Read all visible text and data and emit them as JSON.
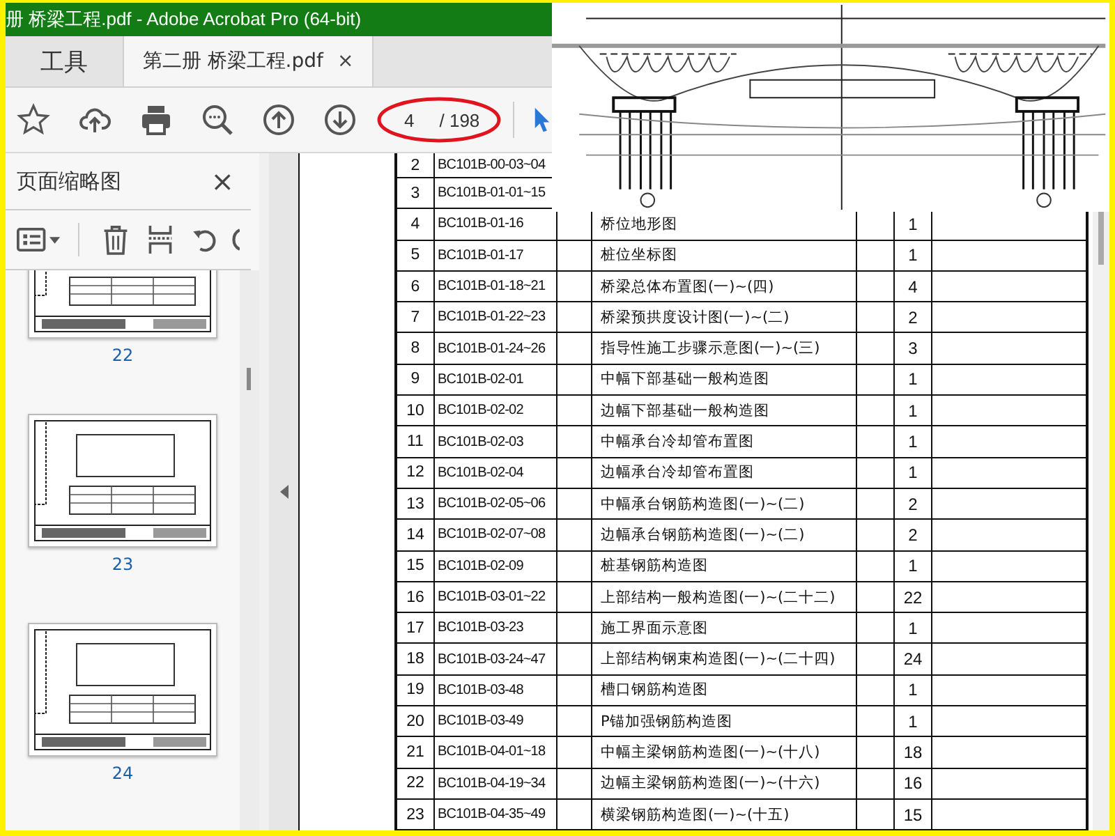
{
  "window": {
    "title": "册 桥梁工程.pdf - Adobe Acrobat Pro (64-bit)"
  },
  "tabs": [
    {
      "label": "工具",
      "selected": false
    },
    {
      "label": "第二册 桥梁工程.pdf",
      "selected": true,
      "close": "×"
    }
  ],
  "toolbar": {
    "page_number": "4",
    "page_total": "/ 198"
  },
  "sidebar": {
    "title": "页面缩略图",
    "close": "×",
    "thumbnails": [
      {
        "label": "22"
      },
      {
        "label": "23"
      },
      {
        "label": "24"
      }
    ]
  },
  "document": {
    "rows": [
      {
        "no": "2",
        "code": "BC101B-00-03~04"
      },
      {
        "no": "3",
        "code": "BC101B-01-01~15"
      },
      {
        "no": "4",
        "code": "BC101B-01-16",
        "title": "桥位地形图",
        "count": "1"
      },
      {
        "no": "5",
        "code": "BC101B-01-17",
        "title": "桩位坐标图",
        "count": "1"
      },
      {
        "no": "6",
        "code": "BC101B-01-18~21",
        "title": "桥梁总体布置图(一)~(四)",
        "count": "4"
      },
      {
        "no": "7",
        "code": "BC101B-01-22~23",
        "title": "桥梁预拱度设计图(一)~(二)",
        "count": "2"
      },
      {
        "no": "8",
        "code": "BC101B-01-24~26",
        "title": "指导性施工步骤示意图(一)~(三)",
        "count": "3"
      },
      {
        "no": "9",
        "code": "BC101B-02-01",
        "title": "中幅下部基础一般构造图",
        "count": "1"
      },
      {
        "no": "10",
        "code": "BC101B-02-02",
        "title": "边幅下部基础一般构造图",
        "count": "1"
      },
      {
        "no": "11",
        "code": "BC101B-02-03",
        "title": "中幅承台冷却管布置图",
        "count": "1"
      },
      {
        "no": "12",
        "code": "BC101B-02-04",
        "title": "边幅承台冷却管布置图",
        "count": "1"
      },
      {
        "no": "13",
        "code": "BC101B-02-05~06",
        "title": "中幅承台钢筋构造图(一)~(二)",
        "count": "2"
      },
      {
        "no": "14",
        "code": "BC101B-02-07~08",
        "title": "边幅承台钢筋构造图(一)~(二)",
        "count": "2"
      },
      {
        "no": "15",
        "code": "BC101B-02-09",
        "title": "桩基钢筋构造图",
        "count": "1"
      },
      {
        "no": "16",
        "code": "BC101B-03-01~22",
        "title": "上部结构一般构造图(一)~(二十二)",
        "count": "22"
      },
      {
        "no": "17",
        "code": "BC101B-03-23",
        "title": "施工界面示意图",
        "count": "1"
      },
      {
        "no": "18",
        "code": "BC101B-03-24~47",
        "title": "上部结构钢束构造图(一)~(二十四)",
        "count": "24"
      },
      {
        "no": "19",
        "code": "BC101B-03-48",
        "title": "槽口钢筋构造图",
        "count": "1"
      },
      {
        "no": "20",
        "code": "BC101B-03-49",
        "title": "P锚加强钢筋构造图",
        "count": "1"
      },
      {
        "no": "21",
        "code": "BC101B-04-01~18",
        "title": "中幅主梁钢筋构造图(一)~(十八)",
        "count": "18"
      },
      {
        "no": "22",
        "code": "BC101B-04-19~34",
        "title": "边幅主梁钢筋构造图(一)~(十六)",
        "count": "16"
      },
      {
        "no": "23",
        "code": "BC101B-04-35~49",
        "title": "横梁钢筋构造图(一)~(十五)",
        "count": "15"
      }
    ]
  }
}
